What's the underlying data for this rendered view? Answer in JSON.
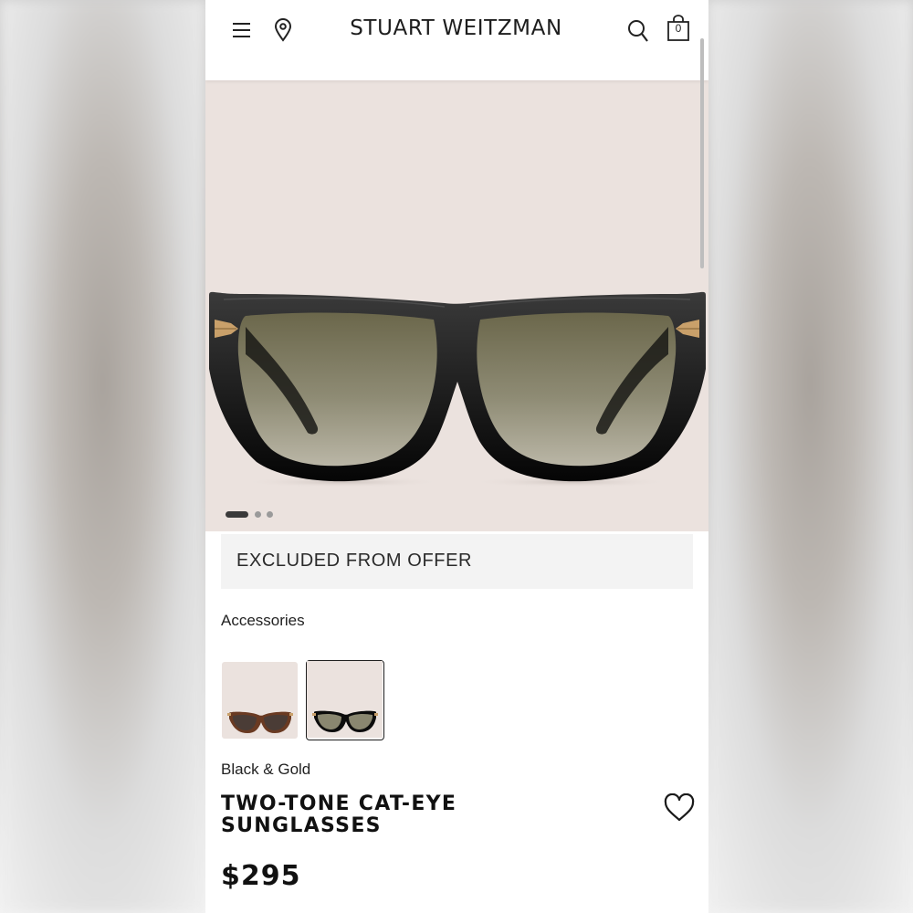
{
  "header": {
    "brand": "STUART WEITZMAN",
    "icons": [
      "menu-icon",
      "location-pin-icon",
      "search-icon",
      "shopping-bag-icon"
    ],
    "cart_count": "0"
  },
  "gallery": {
    "image": "black-gold-cat-eye-sunglasses",
    "slide_count": 3,
    "active_slide": 1
  },
  "offer": {
    "label": "EXCLUDED FROM OFFER"
  },
  "product": {
    "category": "Accessories",
    "swatches": [
      {
        "name": "tortoise-swatch",
        "selected": false
      },
      {
        "name": "black-gold-swatch",
        "selected": true
      }
    ],
    "color": "Black & Gold",
    "title_line1": "TWO-TONE CAT-EYE",
    "title_line2": "SUNGLASSES",
    "price": "$295"
  },
  "colors": {
    "hero_background": "#ebe2de",
    "frame_black": "#0c0c0c",
    "hinge_gold": "#c9a06a",
    "lens_top": "#6f6a4f",
    "lens_bottom": "#b7b3a2"
  }
}
